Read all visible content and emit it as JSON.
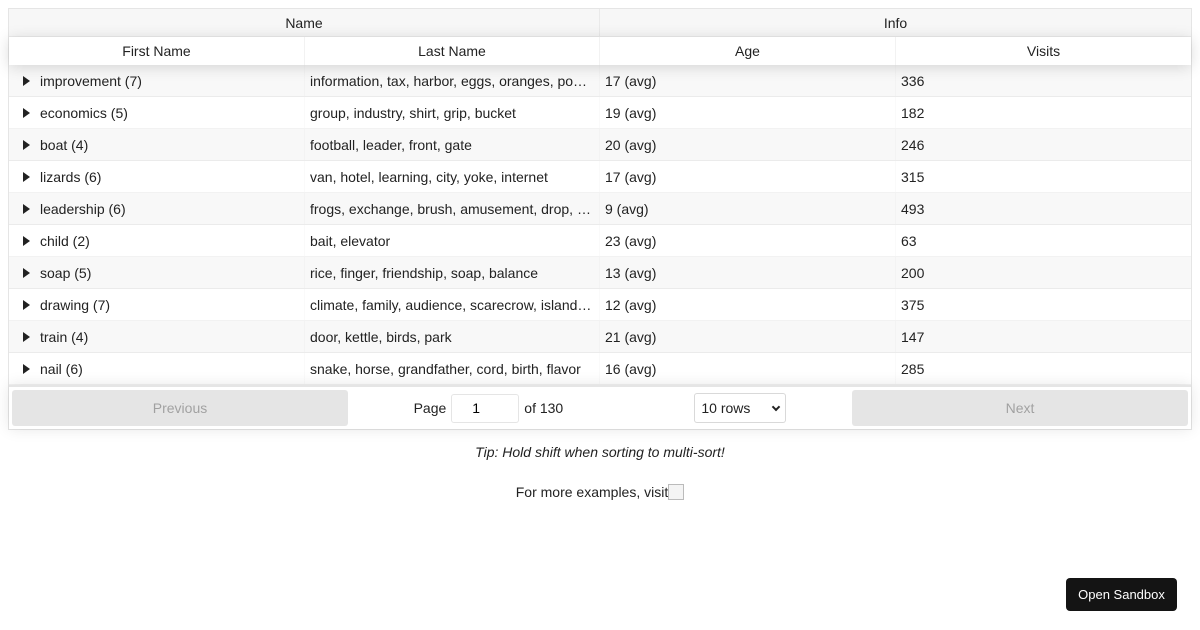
{
  "header_groups": [
    "Name",
    "Info"
  ],
  "columns": [
    "First Name",
    "Last Name",
    "Age",
    "Visits"
  ],
  "rows": [
    {
      "first": "improvement (7)",
      "last": "information, tax, harbor, eggs, oranges, pocket, shoe",
      "age": "17 (avg)",
      "visits": "336"
    },
    {
      "first": "economics (5)",
      "last": "group, industry, shirt, grip, bucket",
      "age": "19 (avg)",
      "visits": "182"
    },
    {
      "first": "boat (4)",
      "last": "football, leader, front, gate",
      "age": "20 (avg)",
      "visits": "246"
    },
    {
      "first": "lizards (6)",
      "last": "van, hotel, learning, city, yoke, internet",
      "age": "17 (avg)",
      "visits": "315"
    },
    {
      "first": "leadership (6)",
      "last": "frogs, exchange, brush, amusement, drop, brain",
      "age": "9 (avg)",
      "visits": "493"
    },
    {
      "first": "child (2)",
      "last": "bait, elevator",
      "age": "23 (avg)",
      "visits": "63"
    },
    {
      "first": "soap (5)",
      "last": "rice, finger, friendship, soap, balance",
      "age": "13 (avg)",
      "visits": "200"
    },
    {
      "first": "drawing (7)",
      "last": "climate, family, audience, scarecrow, island, rest, cake",
      "age": "12 (avg)",
      "visits": "375"
    },
    {
      "first": "train (4)",
      "last": "door, kettle, birds, park",
      "age": "21 (avg)",
      "visits": "147"
    },
    {
      "first": "nail (6)",
      "last": "snake, horse, grandfather, cord, birth, flavor",
      "age": "16 (avg)",
      "visits": "285"
    }
  ],
  "pagination": {
    "previous_label": "Previous",
    "next_label": "Next",
    "page_label": "Page",
    "page_value": "1",
    "of_label": "of 130",
    "rows_option": "10 rows"
  },
  "tip": "Tip: Hold shift when sorting to multi-sort!",
  "more_examples": "For more examples, visit",
  "sandbox_button": "Open Sandbox"
}
